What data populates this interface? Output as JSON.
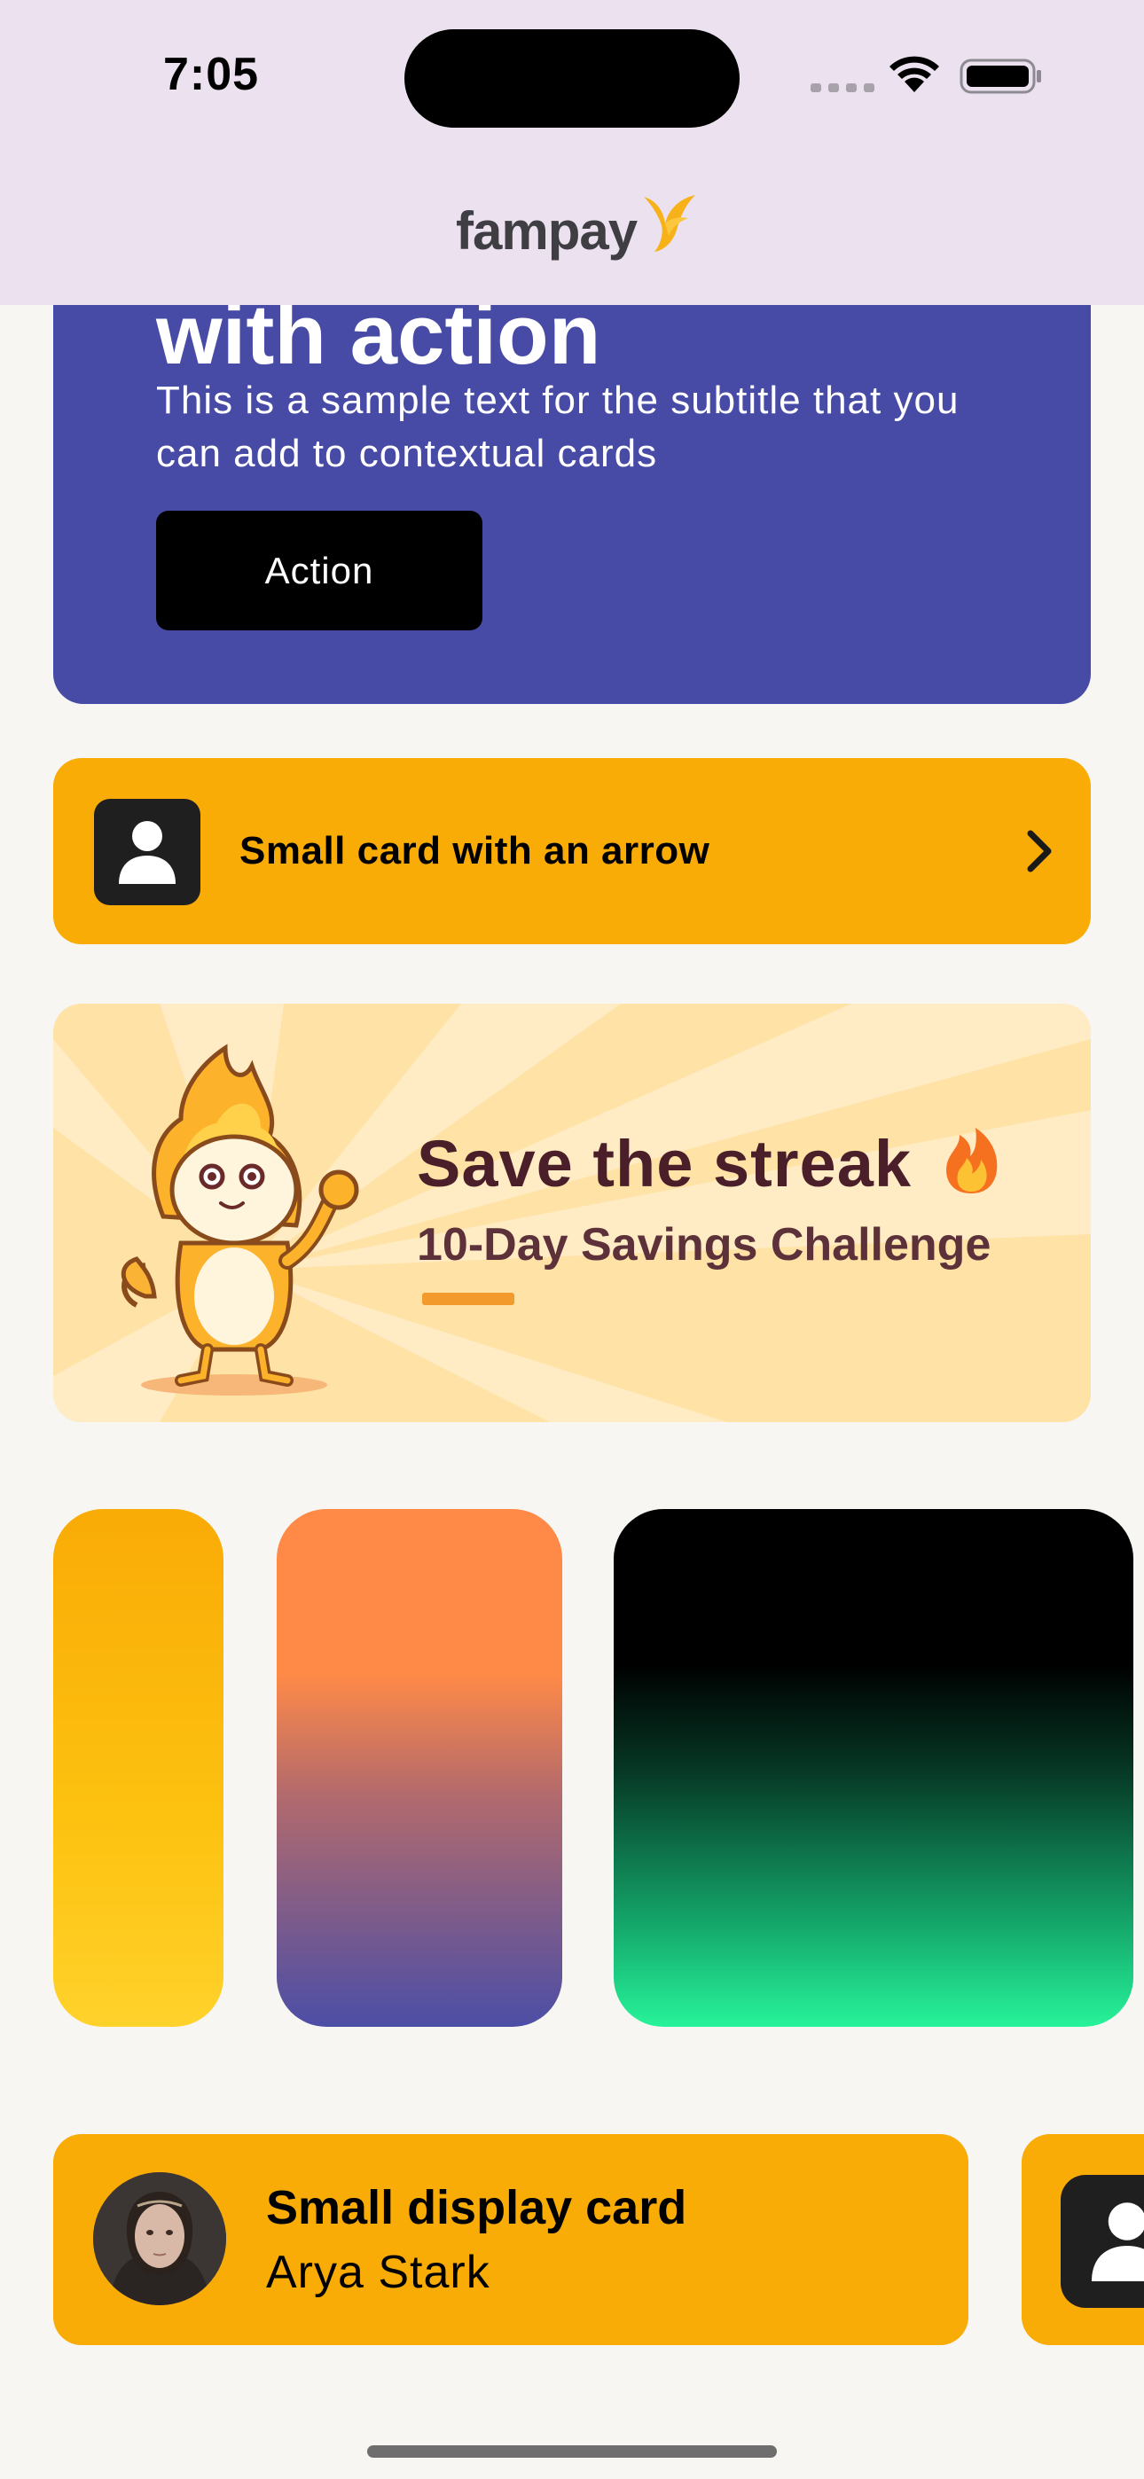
{
  "status_bar": {
    "time": "7:05"
  },
  "header": {
    "brand": "fampay"
  },
  "hero_card": {
    "title": "with action",
    "subtitle": "This is a sample text for the subtitle that you can add to contextual cards",
    "action_label": "Action",
    "background": "#474ba6"
  },
  "arrow_card": {
    "label": "Small card with an arrow",
    "background": "#f9ab06"
  },
  "streak_banner": {
    "title": "Save the streak",
    "subtitle": "10-Day Savings Challenge"
  },
  "gradient_cards": [
    {
      "colors": [
        "#f9ab06",
        "#ffd22b"
      ]
    },
    {
      "colors": [
        "#ff8a48",
        "#4c4ea6"
      ]
    },
    {
      "colors": [
        "#000000",
        "#27f39a"
      ]
    }
  ],
  "display_card": {
    "title": "Small display card",
    "subtitle": "Arya Stark"
  }
}
